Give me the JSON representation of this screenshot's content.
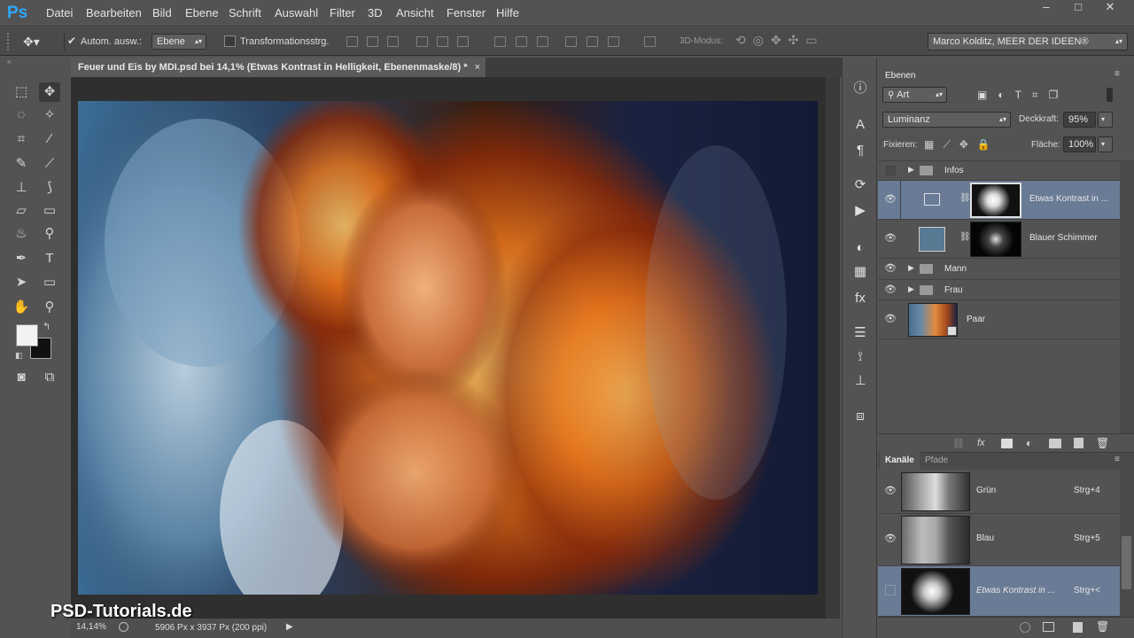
{
  "app": {
    "logo": "Ps"
  },
  "menu": [
    "Datei",
    "Bearbeiten",
    "Bild",
    "Ebene",
    "Schrift",
    "Auswahl",
    "Filter",
    "3D",
    "Ansicht",
    "Fenster",
    "Hilfe"
  ],
  "window": {
    "min": "–",
    "max": "□",
    "close": "✕"
  },
  "options": {
    "auto_select_label": "Autom. ausw.:",
    "auto_select_value": "Ebene",
    "transform_label": "Transformationsstrg.",
    "mode3d_label": "3D-Modus:",
    "workspace": "Marco Kolditz, MEER DER IDEEN®"
  },
  "document": {
    "tab_title": "Feuer und Eis by MDI.psd bei 14,1% (Etwas Kontrast in Helligkeit, Ebenenmaske/8) *",
    "tab_close": "×"
  },
  "status": {
    "zoom": "14,14%",
    "size": "5906 Px x 3937 Px (200 ppi)"
  },
  "watermark": "PSD-Tutorials.de",
  "layers_panel": {
    "tab": "Ebenen",
    "filter": "Art",
    "blend_mode": "Luminanz",
    "opacity_label": "Deckkraft:",
    "opacity_value": "95%",
    "lock_label": "Fixieren:",
    "fill_label": "Fläche:",
    "fill_value": "100%",
    "layers": [
      {
        "name": "Infos",
        "type": "group",
        "visible": false
      },
      {
        "name": "Etwas Kontrast in ...",
        "type": "adjustment",
        "visible": true,
        "selected": true
      },
      {
        "name": "Blauer Schimmer",
        "type": "fill",
        "visible": true
      },
      {
        "name": "Mann",
        "type": "group",
        "visible": true
      },
      {
        "name": "Frau",
        "type": "group",
        "visible": true
      },
      {
        "name": "Paar",
        "type": "smart",
        "visible": true
      }
    ]
  },
  "channels_panel": {
    "tabs": [
      "Kanäle",
      "Pfade"
    ],
    "channels": [
      {
        "name": "Grün",
        "shortcut": "Strg+4",
        "visible": true
      },
      {
        "name": "Blau",
        "shortcut": "Strg+5",
        "visible": true
      },
      {
        "name": "Etwas Kontrast in ...",
        "shortcut": "Strg+<",
        "visible": false,
        "selected": true
      }
    ]
  },
  "colors": {
    "accent": "#31a8ff",
    "selected_row": "#6a7b96",
    "panel": "#535353"
  }
}
